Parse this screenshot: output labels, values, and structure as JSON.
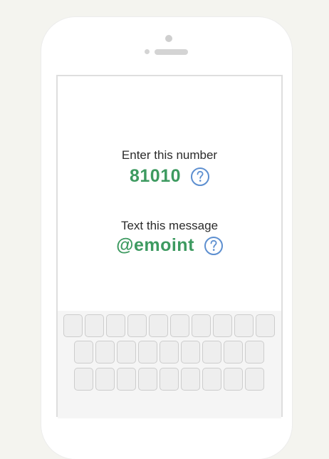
{
  "screen": {
    "number_instruction": "Enter this number",
    "number_value": "81010",
    "message_instruction": "Text this message",
    "message_value": "@emoint",
    "help_symbol": "?"
  },
  "icons": {
    "help": "question-circle-icon"
  },
  "colors": {
    "background": "#f4f4ef",
    "phone_body": "#ffffff",
    "highlight_green": "#3d9a60",
    "help_blue": "#5d8fd0",
    "key_fill": "#eeeeee",
    "key_border": "#cdcdcd"
  },
  "keyboard": {
    "rows": [
      10,
      9,
      9
    ]
  }
}
